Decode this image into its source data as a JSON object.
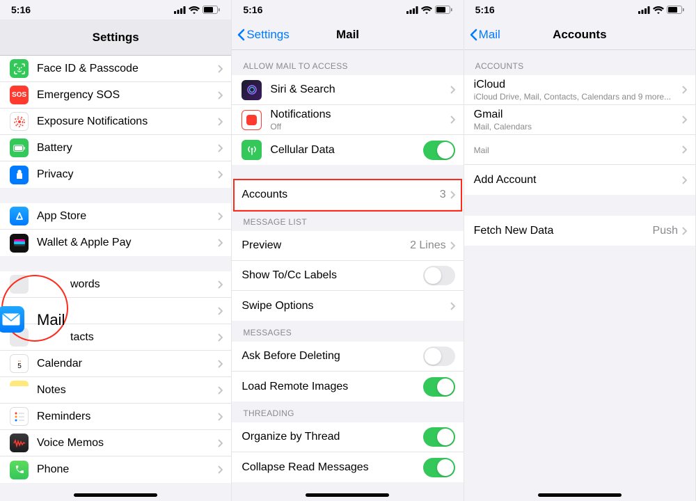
{
  "status": {
    "time": "5:16"
  },
  "screen1": {
    "title": "Settings",
    "items": [
      {
        "label": "Face ID & Passcode",
        "icon": "ic-green"
      },
      {
        "label": "Emergency SOS",
        "icon": "ic-red",
        "text": "SOS"
      },
      {
        "label": "Exposure Notifications",
        "icon": "ic-white"
      },
      {
        "label": "Battery",
        "icon": "ic-green"
      },
      {
        "label": "Privacy",
        "icon": "ic-blue"
      }
    ],
    "items2": [
      {
        "label": "App Store",
        "icon": "ic-gradient-blue"
      },
      {
        "label": "Wallet & Apple Pay",
        "icon": "ic-dark"
      }
    ],
    "items3": [
      {
        "label": "words",
        "icon": "ic-greytile"
      },
      {
        "label": "Mail",
        "icon": "ic-gradient-blue"
      },
      {
        "label": "tacts",
        "icon": "ic-greytile"
      },
      {
        "label": "Calendar",
        "icon": "ic-white"
      },
      {
        "label": "Notes",
        "icon": "ic-yellow"
      },
      {
        "label": "Reminders",
        "icon": "ic-white"
      },
      {
        "label": "Voice Memos",
        "icon": "ic-gradient-dark"
      },
      {
        "label": "Phone",
        "icon": "ic-gradient-green"
      }
    ],
    "mail_label": "Mail"
  },
  "screen2": {
    "back": "Settings",
    "title": "Mail",
    "section_allow": "ALLOW MAIL TO ACCESS",
    "siri": "Siri & Search",
    "notifications": "Notifications",
    "notifications_sub": "Off",
    "cellular": "Cellular Data",
    "accounts": "Accounts",
    "accounts_count": "3",
    "section_msglist": "MESSAGE LIST",
    "preview": "Preview",
    "preview_value": "2 Lines",
    "showtocc": "Show To/Cc Labels",
    "swipe": "Swipe Options",
    "section_messages": "MESSAGES",
    "askdelete": "Ask Before Deleting",
    "loadremote": "Load Remote Images",
    "section_threading": "THREADING",
    "organize": "Organize by Thread",
    "collapse": "Collapse Read Messages"
  },
  "screen3": {
    "back": "Mail",
    "title": "Accounts",
    "section_accounts": "ACCOUNTS",
    "icloud": "iCloud",
    "icloud_sub": "iCloud Drive, Mail, Contacts, Calendars and 9 more...",
    "gmail": "Gmail",
    "gmail_sub": "Mail, Calendars",
    "redacted_sub": "Mail",
    "add": "Add Account",
    "fetch": "Fetch New Data",
    "fetch_value": "Push"
  }
}
